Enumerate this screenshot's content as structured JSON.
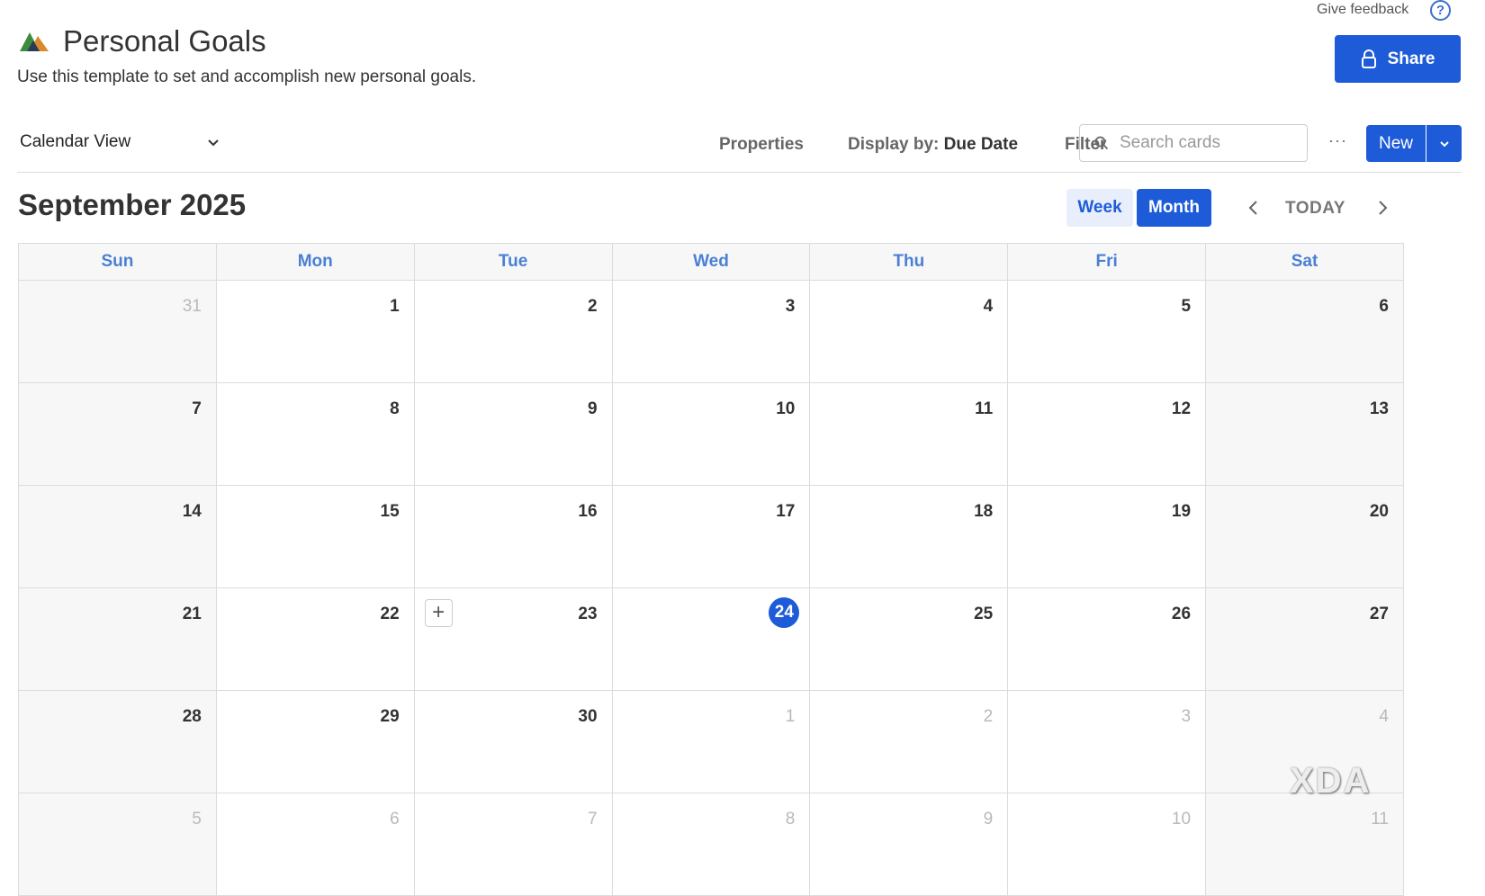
{
  "header": {
    "feedback_label": "Give feedback",
    "help_glyph": "?",
    "title": "Personal Goals",
    "subtitle": "Use this template to set and accomplish new personal goals.",
    "share_label": "Share",
    "logo_icon": "mountains-logo-icon"
  },
  "toolbar": {
    "view_label": "Calendar View",
    "properties_label": "Properties",
    "display_by_prefix": "Display by:",
    "display_by_value": "Due Date",
    "filter_label": "Filter",
    "search_placeholder": "Search cards",
    "search_value": "",
    "more_label": "···",
    "new_label": "New"
  },
  "calendar": {
    "month_title": "September 2025",
    "week_label": "Week",
    "month_label": "Month",
    "today_label": "TODAY",
    "active_mode": "Month",
    "add_glyph": "+",
    "weekdays": [
      "Sun",
      "Mon",
      "Tue",
      "Wed",
      "Thu",
      "Fri",
      "Sat"
    ],
    "weeks": [
      [
        {
          "d": "31",
          "o": true
        },
        {
          "d": "1"
        },
        {
          "d": "2"
        },
        {
          "d": "3"
        },
        {
          "d": "4"
        },
        {
          "d": "5"
        },
        {
          "d": "6"
        }
      ],
      [
        {
          "d": "7"
        },
        {
          "d": "8"
        },
        {
          "d": "9"
        },
        {
          "d": "10"
        },
        {
          "d": "11"
        },
        {
          "d": "12"
        },
        {
          "d": "13"
        }
      ],
      [
        {
          "d": "14"
        },
        {
          "d": "15"
        },
        {
          "d": "16"
        },
        {
          "d": "17"
        },
        {
          "d": "18"
        },
        {
          "d": "19"
        },
        {
          "d": "20"
        }
      ],
      [
        {
          "d": "21"
        },
        {
          "d": "22"
        },
        {
          "d": "23",
          "add": true
        },
        {
          "d": "24",
          "today": true
        },
        {
          "d": "25"
        },
        {
          "d": "26"
        },
        {
          "d": "27"
        }
      ],
      [
        {
          "d": "28"
        },
        {
          "d": "29"
        },
        {
          "d": "30"
        },
        {
          "d": "1",
          "o": true
        },
        {
          "d": "2",
          "o": true
        },
        {
          "d": "3",
          "o": true
        },
        {
          "d": "4",
          "o": true
        }
      ],
      [
        {
          "d": "5",
          "o": true
        },
        {
          "d": "6",
          "o": true
        },
        {
          "d": "7",
          "o": true
        },
        {
          "d": "8",
          "o": true
        },
        {
          "d": "9",
          "o": true
        },
        {
          "d": "10",
          "o": true
        },
        {
          "d": "11",
          "o": true
        }
      ]
    ]
  },
  "watermark": {
    "text": "XDA"
  },
  "colors": {
    "accent": "#1d5bd8",
    "weekday_text": "#4a7fd6",
    "muted_day": "#b9b9b9",
    "weekend_bg": "#f7f7f7"
  }
}
